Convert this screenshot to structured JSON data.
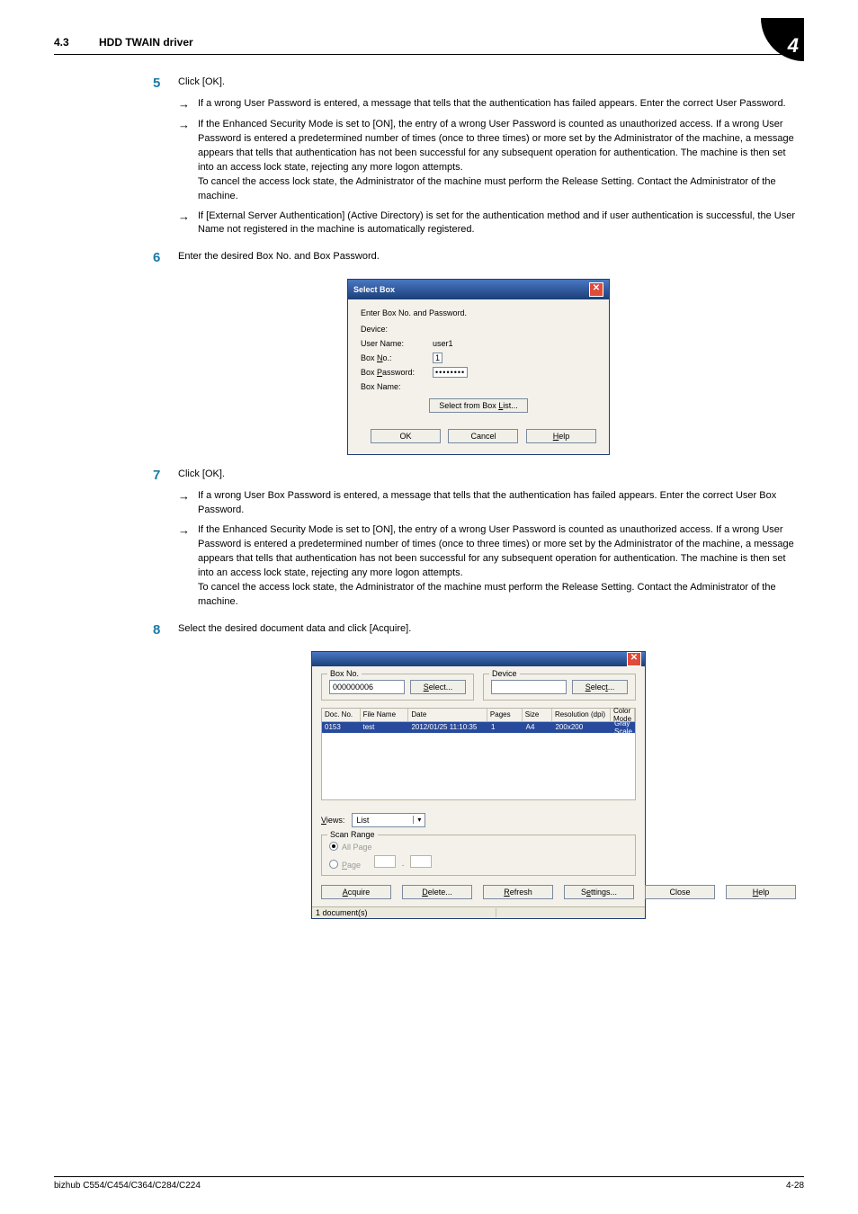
{
  "header": {
    "section_num": "4.3",
    "section_title": "HDD TWAIN driver",
    "chapter": "4"
  },
  "steps": {
    "s5": {
      "num": "5",
      "text": "Click [OK].",
      "bullets": [
        "If a wrong User Password is entered, a message that tells that the authentication has failed appears. Enter the correct User Password.",
        "If the Enhanced Security Mode is set to [ON], the entry of a wrong User Password is counted as unauthorized access. If a wrong User Password is entered a predetermined number of times (once to three times) or more set by the Administrator of the machine, a message appears that tells that authentication has not been successful for any subsequent operation for authentication. The machine is then set into an access lock state, rejecting any more logon attempts.\nTo cancel the access lock state, the Administrator of the machine must perform the Release Setting. Contact the Administrator of the machine.",
        "If [External Server Authentication] (Active Directory) is set for the authentication method and if user authentication is successful, the User Name not registered in the machine is automatically registered."
      ]
    },
    "s6": {
      "num": "6",
      "text": "Enter the desired Box No. and Box Password."
    },
    "s7": {
      "num": "7",
      "text": "Click [OK].",
      "bullets": [
        "If a wrong User Box Password is entered, a message that tells that the authentication has failed appears. Enter the correct User Box Password.",
        "If the Enhanced Security Mode is set to [ON], the entry of a wrong User Password is counted as unauthorized access. If a wrong User Password is entered a predetermined number of times (once to three times) or more set by the Administrator of the machine, a message appears that tells that authentication has not been successful for any subsequent operation for authentication. The machine is then set into an access lock state, rejecting any more logon attempts.\nTo cancel the access lock state, the Administrator of the machine must perform the Release Setting. Contact the Administrator of the machine."
      ]
    },
    "s8": {
      "num": "8",
      "text": "Select the desired document data and click [Acquire]."
    }
  },
  "dlg1": {
    "title": "Select Box",
    "subtitle": "Enter Box No. and Password.",
    "device_lbl": "Device:",
    "device_val": "",
    "username_lbl": "User Name:",
    "username_val": "user1",
    "boxno_lbl": "Box No.:",
    "boxno_val": "1",
    "boxpw_lbl": "Box Password:",
    "boxpw_val": "••••••••",
    "boxname_lbl": "Box Name:",
    "btn_select_list": "Select from Box List...",
    "btn_ok": "OK",
    "btn_cancel": "Cancel",
    "btn_help": "Help"
  },
  "dlg2": {
    "boxno_legend": "Box No.",
    "boxno_val": "000000006",
    "select_btn": "Select...",
    "device_legend": "Device",
    "device_val": "",
    "select_btn2": "Select...",
    "cols": {
      "doc": "Doc. No.",
      "name": "File Name",
      "date": "Date",
      "pages": "Pages",
      "size": "Size",
      "res": "Resolution (dpi)",
      "mode": "Color Mode"
    },
    "row": {
      "doc": "0153",
      "name": "test",
      "date": "2012/01/25 11:10:35",
      "pages": "1",
      "size": "A4",
      "res": "200x200",
      "mode": "Gray Scale"
    },
    "views_lbl": "Views:",
    "views_val": "List",
    "scan_legend": "Scan Range",
    "all_page": "All Page",
    "page_lbl": "Page",
    "dash": "-",
    "btn_acquire": "Acquire",
    "btn_delete": "Delete...",
    "btn_refresh": "Refresh",
    "btn_settings": "Settings...",
    "btn_close": "Close",
    "btn_help": "Help",
    "status": "1 document(s)"
  },
  "footer": {
    "left": "bizhub C554/C454/C364/C284/C224",
    "right": "4-28"
  }
}
